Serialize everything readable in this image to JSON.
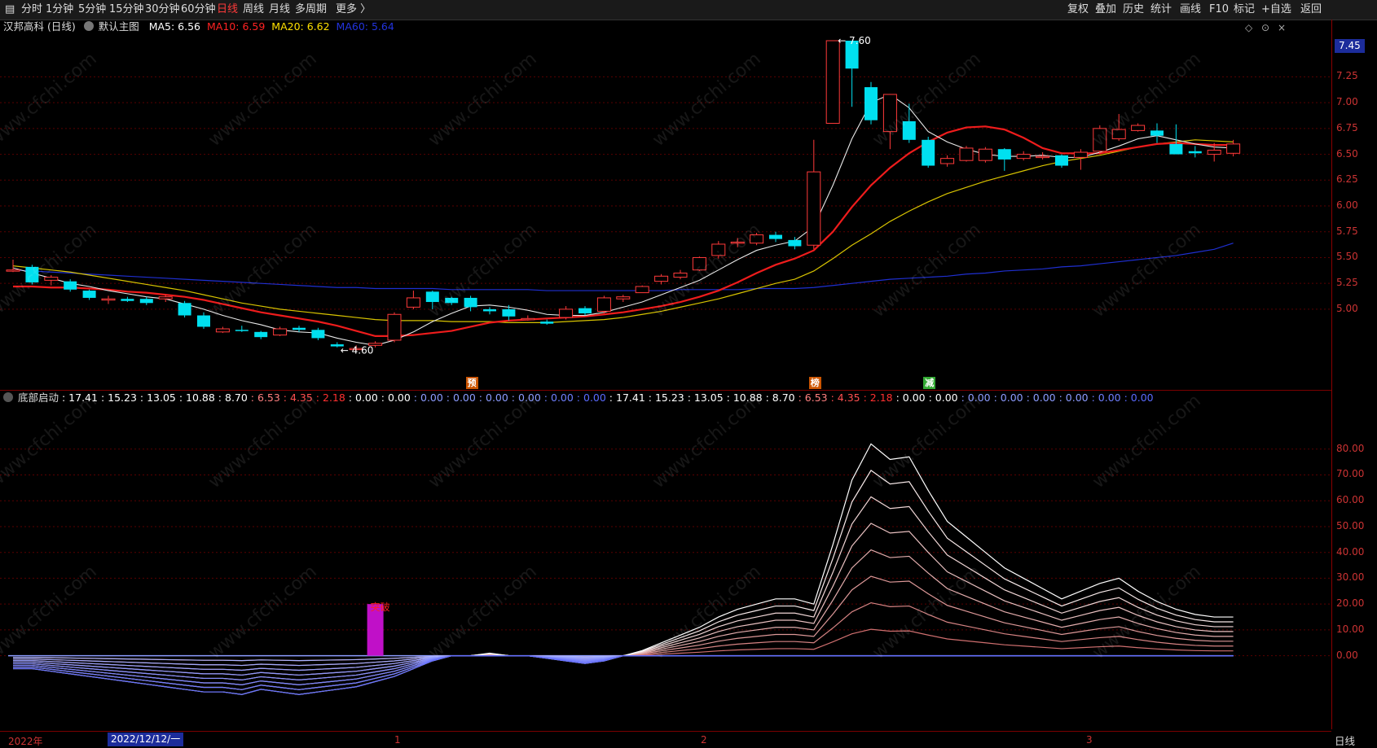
{
  "toolbar": {
    "tabs": [
      "分时",
      "1分钟",
      "5分钟",
      "15分钟",
      "30分钟",
      "60分钟",
      "日线",
      "周线",
      "月线",
      "多周期",
      "更多 〉"
    ],
    "active": "日线",
    "right": [
      "复权",
      "叠加",
      "历史",
      "统计",
      "画线",
      "F10",
      "标记",
      "+自选",
      "返回"
    ]
  },
  "main_panel": {
    "title": "汉邦高科 (日线)",
    "template": "默认主图",
    "ma": [
      {
        "name": "MA5",
        "value": "6.56",
        "color": "#ffffff"
      },
      {
        "name": "MA10",
        "value": "6.59",
        "color": "#ff2222"
      },
      {
        "name": "MA20",
        "value": "6.62",
        "color": "#ffe000"
      },
      {
        "name": "MA60",
        "value": "5.64",
        "color": "#2233dd"
      }
    ],
    "last_price": "7.45",
    "high_label": "7.60",
    "low_label": "4.60",
    "signals": [
      {
        "text": "预",
        "color": "#cc5500"
      },
      {
        "text": "榜",
        "color": "#cc5500"
      },
      {
        "text": "减",
        "color": "#33aa33"
      }
    ],
    "corner_icons": [
      "◇",
      "⊙",
      "×"
    ]
  },
  "price_axis": [
    "7.25",
    "7.00",
    "6.75",
    "6.50",
    "6.25",
    "6.00",
    "5.75",
    "5.50",
    "5.25",
    "5.00"
  ],
  "indicator_panel": {
    "name": "底部启动",
    "values": [
      "17.41",
      "15.23",
      "13.05",
      "10.88",
      "8.70",
      "6.53",
      "4.35",
      "2.18",
      "0.00",
      "0.00",
      "0.00",
      "0.00",
      "0.00",
      "0.00",
      "0.00",
      "0.00",
      "17.41",
      "15.23",
      "13.05",
      "10.88",
      "8.70",
      "6.53",
      "4.35",
      "2.18",
      "0.00",
      "0.00",
      "0.00",
      "0.00",
      "0.00",
      "0.00",
      "0.00",
      "0.00"
    ],
    "value_colors": [
      "#ffffff",
      "#ffffff",
      "#ffffff",
      "#ffffff",
      "#ffffff",
      "#ff8080",
      "#ff5050",
      "#ff3030",
      "#ffffff",
      "#ffffff",
      "#8c9cff",
      "#8c9cff",
      "#8c9cff",
      "#8c9cff",
      "#6f7fff",
      "#5a6aff",
      "#ffffff",
      "#ffffff",
      "#ffffff",
      "#ffffff",
      "#ffffff",
      "#ff8080",
      "#ff5050",
      "#ff3030",
      "#ffffff",
      "#ffffff",
      "#8c9cff",
      "#8c9cff",
      "#8c9cff",
      "#8c9cff",
      "#6f7fff",
      "#5a6aff"
    ],
    "breakout_label": "突破",
    "axis": [
      "80.00",
      "70.00",
      "60.00",
      "50.00",
      "40.00",
      "30.00",
      "20.00",
      "10.00",
      "0.00"
    ]
  },
  "date_bar": {
    "year": "2022年",
    "cursor": "2022/12/12/一",
    "months": [
      "1",
      "2",
      "3"
    ],
    "period": "日线"
  },
  "watermark": "www.cfchi.com",
  "chart_data": {
    "type": "candlestick",
    "ylim": [
      4.55,
      7.6
    ],
    "candles": [
      {
        "o": 5.38,
        "c": 5.38,
        "h": 5.48,
        "l": 5.36
      },
      {
        "o": 5.41,
        "c": 5.26,
        "h": 5.43,
        "l": 5.24
      },
      {
        "o": 5.28,
        "c": 5.31,
        "h": 5.33,
        "l": 5.23
      },
      {
        "o": 5.27,
        "c": 5.19,
        "h": 5.29,
        "l": 5.17
      },
      {
        "o": 5.18,
        "c": 5.11,
        "h": 5.19,
        "l": 5.09
      },
      {
        "o": 5.1,
        "c": 5.1,
        "h": 5.13,
        "l": 5.05
      },
      {
        "o": 5.1,
        "c": 5.08,
        "h": 5.12,
        "l": 5.07
      },
      {
        "o": 5.1,
        "c": 5.06,
        "h": 5.12,
        "l": 5.04
      },
      {
        "o": 5.1,
        "c": 5.12,
        "h": 5.14,
        "l": 5.07
      },
      {
        "o": 5.06,
        "c": 4.94,
        "h": 5.08,
        "l": 4.92
      },
      {
        "o": 4.94,
        "c": 4.83,
        "h": 4.97,
        "l": 4.81
      },
      {
        "o": 4.78,
        "c": 4.81,
        "h": 4.83,
        "l": 4.77
      },
      {
        "o": 4.8,
        "c": 4.79,
        "h": 4.84,
        "l": 4.78
      },
      {
        "o": 4.78,
        "c": 4.73,
        "h": 4.79,
        "l": 4.71
      },
      {
        "o": 4.75,
        "c": 4.81,
        "h": 4.83,
        "l": 4.74
      },
      {
        "o": 4.82,
        "c": 4.8,
        "h": 4.84,
        "l": 4.78
      },
      {
        "o": 4.8,
        "c": 4.72,
        "h": 4.82,
        "l": 4.7
      },
      {
        "o": 4.66,
        "c": 4.64,
        "h": 4.68,
        "l": 4.63
      },
      {
        "o": 4.62,
        "c": 4.62,
        "h": 4.65,
        "l": 4.6
      },
      {
        "o": 4.65,
        "c": 4.67,
        "h": 4.69,
        "l": 4.63
      },
      {
        "o": 4.7,
        "c": 4.95,
        "h": 4.97,
        "l": 4.68
      },
      {
        "o": 5.02,
        "c": 5.11,
        "h": 5.18,
        "l": 5.0
      },
      {
        "o": 5.17,
        "c": 5.07,
        "h": 5.18,
        "l": 5.0
      },
      {
        "o": 5.11,
        "c": 5.06,
        "h": 5.12,
        "l": 5.04
      },
      {
        "o": 5.11,
        "c": 5.02,
        "h": 5.13,
        "l": 4.98
      },
      {
        "o": 5.0,
        "c": 4.98,
        "h": 5.02,
        "l": 4.95
      },
      {
        "o": 5.0,
        "c": 4.93,
        "h": 5.04,
        "l": 4.89
      },
      {
        "o": 4.91,
        "c": 4.91,
        "h": 4.94,
        "l": 4.89
      },
      {
        "o": 4.88,
        "c": 4.86,
        "h": 4.9,
        "l": 4.85
      },
      {
        "o": 4.92,
        "c": 5.0,
        "h": 5.03,
        "l": 4.9
      },
      {
        "o": 5.01,
        "c": 4.96,
        "h": 5.03,
        "l": 4.94
      },
      {
        "o": 4.98,
        "c": 5.11,
        "h": 5.13,
        "l": 4.96
      },
      {
        "o": 5.1,
        "c": 5.12,
        "h": 5.14,
        "l": 5.07
      },
      {
        "o": 5.16,
        "c": 5.22,
        "h": 5.23,
        "l": 5.16
      },
      {
        "o": 5.27,
        "c": 5.32,
        "h": 5.34,
        "l": 5.24
      },
      {
        "o": 5.31,
        "c": 5.35,
        "h": 5.38,
        "l": 5.29
      },
      {
        "o": 5.38,
        "c": 5.5,
        "h": 5.51,
        "l": 5.37
      },
      {
        "o": 5.52,
        "c": 5.63,
        "h": 5.66,
        "l": 5.49
      },
      {
        "o": 5.65,
        "c": 5.65,
        "h": 5.69,
        "l": 5.6
      },
      {
        "o": 5.64,
        "c": 5.72,
        "h": 5.74,
        "l": 5.62
      },
      {
        "o": 5.72,
        "c": 5.68,
        "h": 5.75,
        "l": 5.65
      },
      {
        "o": 5.67,
        "c": 5.61,
        "h": 5.7,
        "l": 5.58
      },
      {
        "o": 5.62,
        "c": 6.33,
        "h": 6.64,
        "l": 5.58
      },
      {
        "o": 6.8,
        "c": 7.6,
        "h": 7.6,
        "l": 6.8
      },
      {
        "o": 7.6,
        "c": 7.33,
        "h": 7.6,
        "l": 6.96
      },
      {
        "o": 7.15,
        "c": 6.83,
        "h": 7.2,
        "l": 6.79
      },
      {
        "o": 6.72,
        "c": 7.08,
        "h": 7.08,
        "l": 6.55
      },
      {
        "o": 6.82,
        "c": 6.64,
        "h": 6.99,
        "l": 6.61
      },
      {
        "o": 6.64,
        "c": 6.39,
        "h": 6.67,
        "l": 6.37
      },
      {
        "o": 6.41,
        "c": 6.46,
        "h": 6.49,
        "l": 6.38
      },
      {
        "o": 6.44,
        "c": 6.56,
        "h": 6.58,
        "l": 6.43
      },
      {
        "o": 6.44,
        "c": 6.55,
        "h": 6.57,
        "l": 6.42
      },
      {
        "o": 6.55,
        "c": 6.45,
        "h": 6.56,
        "l": 6.34
      },
      {
        "o": 6.46,
        "c": 6.5,
        "h": 6.53,
        "l": 6.44
      },
      {
        "o": 6.48,
        "c": 6.48,
        "h": 6.52,
        "l": 6.45
      },
      {
        "o": 6.49,
        "c": 6.39,
        "h": 6.5,
        "l": 6.37
      },
      {
        "o": 6.47,
        "c": 6.52,
        "h": 6.55,
        "l": 6.35
      },
      {
        "o": 6.53,
        "c": 6.75,
        "h": 6.78,
        "l": 6.5
      },
      {
        "o": 6.65,
        "c": 6.74,
        "h": 6.89,
        "l": 6.63
      },
      {
        "o": 6.73,
        "c": 6.78,
        "h": 6.8,
        "l": 6.72
      },
      {
        "o": 6.73,
        "c": 6.68,
        "h": 6.8,
        "l": 6.61
      },
      {
        "o": 6.6,
        "c": 6.5,
        "h": 6.79,
        "l": 6.5
      },
      {
        "o": 6.53,
        "c": 6.51,
        "h": 6.58,
        "l": 6.47
      },
      {
        "o": 6.5,
        "c": 6.54,
        "h": 6.61,
        "l": 6.43
      },
      {
        "o": 6.51,
        "c": 6.6,
        "h": 6.64,
        "l": 6.48
      }
    ],
    "ma5": [
      5.4,
      5.35,
      5.3,
      5.25,
      5.22,
      5.18,
      5.15,
      5.12,
      5.1,
      5.05,
      5.0,
      4.94,
      4.89,
      4.85,
      4.8,
      4.78,
      4.77,
      4.72,
      4.68,
      4.65,
      4.7,
      4.78,
      4.88,
      4.96,
      5.03,
      5.04,
      5.02,
      4.99,
      4.95,
      4.94,
      4.94,
      4.97,
      5.02,
      5.07,
      5.14,
      5.21,
      5.28,
      5.38,
      5.48,
      5.57,
      5.62,
      5.66,
      5.8,
      6.2,
      6.65,
      7.0,
      7.08,
      6.95,
      6.72,
      6.62,
      6.55,
      6.5,
      6.48,
      6.48,
      6.49,
      6.47,
      6.47,
      6.52,
      6.58,
      6.65,
      6.68,
      6.64,
      6.6,
      6.57,
      6.56
    ],
    "ma10": [
      5.22,
      5.22,
      5.21,
      5.21,
      5.2,
      5.19,
      5.17,
      5.16,
      5.14,
      5.12,
      5.09,
      5.05,
      5.01,
      4.97,
      4.94,
      4.91,
      4.88,
      4.84,
      4.79,
      4.74,
      4.74,
      4.75,
      4.77,
      4.79,
      4.83,
      4.87,
      4.89,
      4.9,
      4.91,
      4.92,
      4.93,
      4.95,
      4.97,
      5.0,
      5.03,
      5.07,
      5.12,
      5.18,
      5.26,
      5.35,
      5.43,
      5.49,
      5.57,
      5.75,
      5.99,
      6.2,
      6.37,
      6.51,
      6.62,
      6.71,
      6.76,
      6.77,
      6.74,
      6.66,
      6.56,
      6.51,
      6.51,
      6.51,
      6.54,
      6.57,
      6.6,
      6.61,
      6.6,
      6.59,
      6.59
    ],
    "ma20": [
      5.42,
      5.4,
      5.38,
      5.36,
      5.33,
      5.3,
      5.27,
      5.24,
      5.21,
      5.18,
      5.14,
      5.1,
      5.06,
      5.03,
      5.0,
      4.98,
      4.96,
      4.94,
      4.92,
      4.9,
      4.89,
      4.89,
      4.89,
      4.88,
      4.88,
      4.88,
      4.87,
      4.87,
      4.87,
      4.88,
      4.89,
      4.9,
      4.92,
      4.95,
      4.98,
      5.02,
      5.06,
      5.1,
      5.15,
      5.2,
      5.25,
      5.29,
      5.37,
      5.49,
      5.62,
      5.73,
      5.85,
      5.95,
      6.04,
      6.12,
      6.18,
      6.24,
      6.29,
      6.34,
      6.39,
      6.43,
      6.46,
      6.49,
      6.53,
      6.57,
      6.6,
      6.62,
      6.64,
      6.63,
      6.62
    ],
    "ma60": [
      5.38,
      5.37,
      5.36,
      5.35,
      5.34,
      5.33,
      5.32,
      5.31,
      5.3,
      5.29,
      5.28,
      5.27,
      5.26,
      5.25,
      5.24,
      5.23,
      5.22,
      5.21,
      5.21,
      5.2,
      5.2,
      5.2,
      5.2,
      5.19,
      5.19,
      5.19,
      5.19,
      5.19,
      5.18,
      5.18,
      5.18,
      5.18,
      5.18,
      5.18,
      5.18,
      5.19,
      5.19,
      5.19,
      5.19,
      5.2,
      5.2,
      5.2,
      5.21,
      5.23,
      5.25,
      5.27,
      5.29,
      5.3,
      5.31,
      5.32,
      5.34,
      5.35,
      5.37,
      5.38,
      5.39,
      5.41,
      5.42,
      5.44,
      5.46,
      5.48,
      5.5,
      5.52,
      5.55,
      5.58,
      5.64
    ],
    "indicator": {
      "ylim": [
        -25,
        90
      ],
      "top_line": [
        -5,
        -5,
        -6,
        -7,
        -8,
        -9,
        -10,
        -11,
        -12,
        -13,
        -14,
        -14,
        -15,
        -13,
        -14,
        -15,
        -14,
        -13,
        -12,
        -10,
        -8,
        -5,
        -2,
        0,
        0,
        1,
        0,
        0,
        -1,
        -2,
        -3,
        -2,
        0,
        2,
        5,
        8,
        11,
        15,
        18,
        20,
        22,
        22,
        20,
        43,
        68,
        82,
        76,
        77,
        64,
        52,
        46,
        40,
        34,
        30,
        26,
        22,
        25,
        28,
        30,
        25,
        21,
        18,
        16,
        15,
        15
      ],
      "breakout_index": 19,
      "breakout_value": 20
    }
  }
}
